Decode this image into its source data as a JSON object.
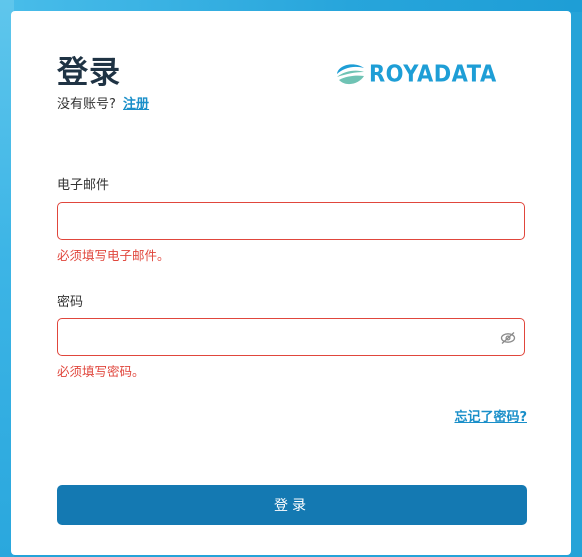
{
  "colors": {
    "page_background": "#25a3d8",
    "card_background": "#ffffff",
    "primary": "#1479b2",
    "link": "#1a8fc9",
    "error": "#e0463c",
    "logo_blue": "#1e9ed6",
    "logo_teal": "#6fc3b4"
  },
  "login": {
    "title": "登录",
    "signup_prompt": "没有账号?",
    "signup_link": "注册",
    "logo_text": "ROYADATA",
    "email": {
      "label": "电子邮件",
      "value": "",
      "error": "必须填写电子邮件。"
    },
    "password": {
      "label": "密码",
      "value": "",
      "error": "必须填写密码。",
      "toggle_icon": "eye-slash-icon"
    },
    "forgot_link": "忘记了密码?",
    "submit_label": "登录"
  }
}
